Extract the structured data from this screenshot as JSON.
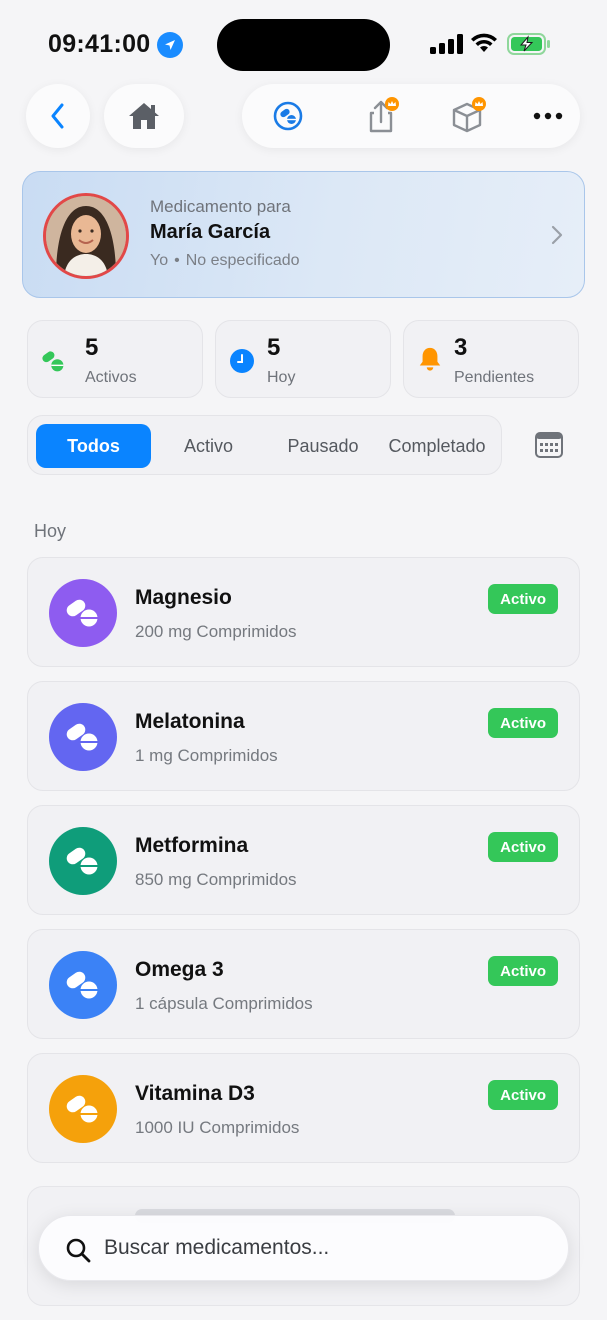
{
  "status_bar": {
    "time": "09:41:00"
  },
  "nav": {
    "back_icon": "chevron-left-icon",
    "home_icon": "home-icon",
    "tools": [
      "pills-circle-icon",
      "share-icon",
      "box-icon",
      "more-icon"
    ]
  },
  "patient": {
    "label": "Medicamento para",
    "name": "María García",
    "relation": "Yo",
    "separator": "•",
    "detail": "No especificado"
  },
  "stats": [
    {
      "value": "5",
      "label": "Activos",
      "icon": "pills-icon",
      "color": "#34c759"
    },
    {
      "value": "5",
      "label": "Hoy",
      "icon": "clock-icon",
      "color": "#0a84ff"
    },
    {
      "value": "3",
      "label": "Pendientes",
      "icon": "bell-icon",
      "color": "#ff9500"
    }
  ],
  "filters": {
    "tabs": [
      "Todos",
      "Activo",
      "Pausado",
      "Completado"
    ],
    "selected": "Todos"
  },
  "section": {
    "title": "Hoy"
  },
  "medications": [
    {
      "name": "Magnesio",
      "dose": "200 mg Comprimidos",
      "status": "Activo",
      "color": "#8e5cf0"
    },
    {
      "name": "Melatonina",
      "dose": "1 mg Comprimidos",
      "status": "Activo",
      "color": "#6366f1"
    },
    {
      "name": "Metformina",
      "dose": "850 mg Comprimidos",
      "status": "Activo",
      "color": "#0f9d7a"
    },
    {
      "name": "Omega 3",
      "dose": "1 cápsula Comprimidos",
      "status": "Activo",
      "color": "#3b82f6"
    },
    {
      "name": "Vitamina D3",
      "dose": "1000 IU Comprimidos",
      "status": "Activo",
      "color": "#f5a10b"
    }
  ],
  "search": {
    "placeholder": "Buscar medicamentos..."
  },
  "colors": {
    "accent": "#0a84ff",
    "active_badge": "#34c759"
  }
}
